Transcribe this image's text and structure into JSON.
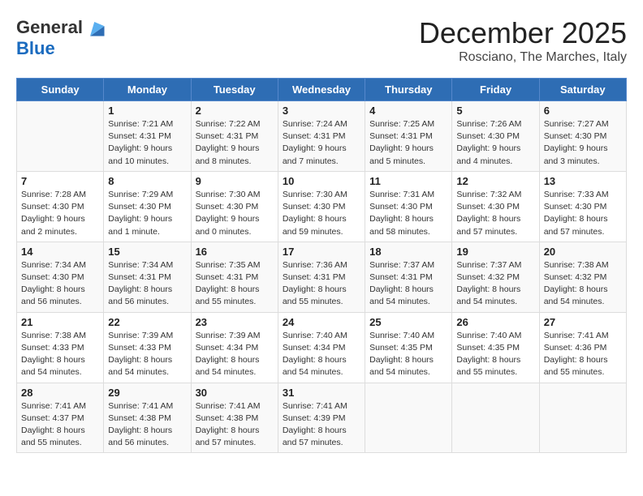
{
  "header": {
    "logo_line1": "General",
    "logo_line2": "Blue",
    "month_title": "December 2025",
    "location": "Rosciano, The Marches, Italy"
  },
  "weekdays": [
    "Sunday",
    "Monday",
    "Tuesday",
    "Wednesday",
    "Thursday",
    "Friday",
    "Saturday"
  ],
  "weeks": [
    [
      {
        "day": "",
        "sunrise": "",
        "sunset": "",
        "daylight": ""
      },
      {
        "day": "1",
        "sunrise": "Sunrise: 7:21 AM",
        "sunset": "Sunset: 4:31 PM",
        "daylight": "Daylight: 9 hours and 10 minutes."
      },
      {
        "day": "2",
        "sunrise": "Sunrise: 7:22 AM",
        "sunset": "Sunset: 4:31 PM",
        "daylight": "Daylight: 9 hours and 8 minutes."
      },
      {
        "day": "3",
        "sunrise": "Sunrise: 7:24 AM",
        "sunset": "Sunset: 4:31 PM",
        "daylight": "Daylight: 9 hours and 7 minutes."
      },
      {
        "day": "4",
        "sunrise": "Sunrise: 7:25 AM",
        "sunset": "Sunset: 4:31 PM",
        "daylight": "Daylight: 9 hours and 5 minutes."
      },
      {
        "day": "5",
        "sunrise": "Sunrise: 7:26 AM",
        "sunset": "Sunset: 4:30 PM",
        "daylight": "Daylight: 9 hours and 4 minutes."
      },
      {
        "day": "6",
        "sunrise": "Sunrise: 7:27 AM",
        "sunset": "Sunset: 4:30 PM",
        "daylight": "Daylight: 9 hours and 3 minutes."
      }
    ],
    [
      {
        "day": "7",
        "sunrise": "Sunrise: 7:28 AM",
        "sunset": "Sunset: 4:30 PM",
        "daylight": "Daylight: 9 hours and 2 minutes."
      },
      {
        "day": "8",
        "sunrise": "Sunrise: 7:29 AM",
        "sunset": "Sunset: 4:30 PM",
        "daylight": "Daylight: 9 hours and 1 minute."
      },
      {
        "day": "9",
        "sunrise": "Sunrise: 7:30 AM",
        "sunset": "Sunset: 4:30 PM",
        "daylight": "Daylight: 9 hours and 0 minutes."
      },
      {
        "day": "10",
        "sunrise": "Sunrise: 7:30 AM",
        "sunset": "Sunset: 4:30 PM",
        "daylight": "Daylight: 8 hours and 59 minutes."
      },
      {
        "day": "11",
        "sunrise": "Sunrise: 7:31 AM",
        "sunset": "Sunset: 4:30 PM",
        "daylight": "Daylight: 8 hours and 58 minutes."
      },
      {
        "day": "12",
        "sunrise": "Sunrise: 7:32 AM",
        "sunset": "Sunset: 4:30 PM",
        "daylight": "Daylight: 8 hours and 57 minutes."
      },
      {
        "day": "13",
        "sunrise": "Sunrise: 7:33 AM",
        "sunset": "Sunset: 4:30 PM",
        "daylight": "Daylight: 8 hours and 57 minutes."
      }
    ],
    [
      {
        "day": "14",
        "sunrise": "Sunrise: 7:34 AM",
        "sunset": "Sunset: 4:30 PM",
        "daylight": "Daylight: 8 hours and 56 minutes."
      },
      {
        "day": "15",
        "sunrise": "Sunrise: 7:34 AM",
        "sunset": "Sunset: 4:31 PM",
        "daylight": "Daylight: 8 hours and 56 minutes."
      },
      {
        "day": "16",
        "sunrise": "Sunrise: 7:35 AM",
        "sunset": "Sunset: 4:31 PM",
        "daylight": "Daylight: 8 hours and 55 minutes."
      },
      {
        "day": "17",
        "sunrise": "Sunrise: 7:36 AM",
        "sunset": "Sunset: 4:31 PM",
        "daylight": "Daylight: 8 hours and 55 minutes."
      },
      {
        "day": "18",
        "sunrise": "Sunrise: 7:37 AM",
        "sunset": "Sunset: 4:31 PM",
        "daylight": "Daylight: 8 hours and 54 minutes."
      },
      {
        "day": "19",
        "sunrise": "Sunrise: 7:37 AM",
        "sunset": "Sunset: 4:32 PM",
        "daylight": "Daylight: 8 hours and 54 minutes."
      },
      {
        "day": "20",
        "sunrise": "Sunrise: 7:38 AM",
        "sunset": "Sunset: 4:32 PM",
        "daylight": "Daylight: 8 hours and 54 minutes."
      }
    ],
    [
      {
        "day": "21",
        "sunrise": "Sunrise: 7:38 AM",
        "sunset": "Sunset: 4:33 PM",
        "daylight": "Daylight: 8 hours and 54 minutes."
      },
      {
        "day": "22",
        "sunrise": "Sunrise: 7:39 AM",
        "sunset": "Sunset: 4:33 PM",
        "daylight": "Daylight: 8 hours and 54 minutes."
      },
      {
        "day": "23",
        "sunrise": "Sunrise: 7:39 AM",
        "sunset": "Sunset: 4:34 PM",
        "daylight": "Daylight: 8 hours and 54 minutes."
      },
      {
        "day": "24",
        "sunrise": "Sunrise: 7:40 AM",
        "sunset": "Sunset: 4:34 PM",
        "daylight": "Daylight: 8 hours and 54 minutes."
      },
      {
        "day": "25",
        "sunrise": "Sunrise: 7:40 AM",
        "sunset": "Sunset: 4:35 PM",
        "daylight": "Daylight: 8 hours and 54 minutes."
      },
      {
        "day": "26",
        "sunrise": "Sunrise: 7:40 AM",
        "sunset": "Sunset: 4:35 PM",
        "daylight": "Daylight: 8 hours and 55 minutes."
      },
      {
        "day": "27",
        "sunrise": "Sunrise: 7:41 AM",
        "sunset": "Sunset: 4:36 PM",
        "daylight": "Daylight: 8 hours and 55 minutes."
      }
    ],
    [
      {
        "day": "28",
        "sunrise": "Sunrise: 7:41 AM",
        "sunset": "Sunset: 4:37 PM",
        "daylight": "Daylight: 8 hours and 55 minutes."
      },
      {
        "day": "29",
        "sunrise": "Sunrise: 7:41 AM",
        "sunset": "Sunset: 4:38 PM",
        "daylight": "Daylight: 8 hours and 56 minutes."
      },
      {
        "day": "30",
        "sunrise": "Sunrise: 7:41 AM",
        "sunset": "Sunset: 4:38 PM",
        "daylight": "Daylight: 8 hours and 57 minutes."
      },
      {
        "day": "31",
        "sunrise": "Sunrise: 7:41 AM",
        "sunset": "Sunset: 4:39 PM",
        "daylight": "Daylight: 8 hours and 57 minutes."
      },
      {
        "day": "",
        "sunrise": "",
        "sunset": "",
        "daylight": ""
      },
      {
        "day": "",
        "sunrise": "",
        "sunset": "",
        "daylight": ""
      },
      {
        "day": "",
        "sunrise": "",
        "sunset": "",
        "daylight": ""
      }
    ]
  ]
}
